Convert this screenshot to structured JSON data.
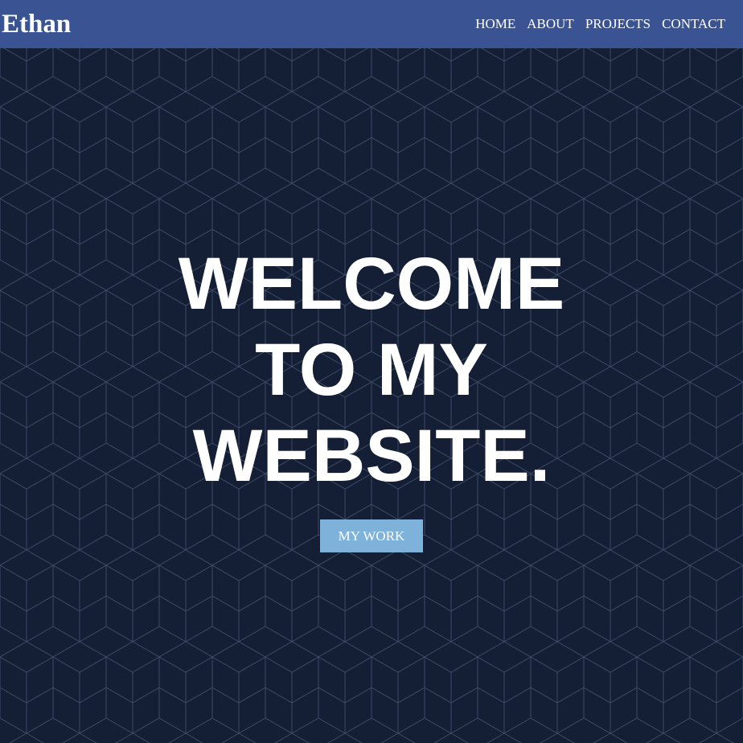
{
  "navbar": {
    "brand": "Ethan",
    "links": [
      "HOME",
      "ABOUT",
      "PROJECTS",
      "CONTACT"
    ]
  },
  "hero": {
    "lines": [
      "WELCOME",
      "TO MY",
      "WEBSITE."
    ],
    "button_label": "MY WORK"
  },
  "colors": {
    "navbar_bg": "#3a5493",
    "page_bg": "#141f36",
    "pattern_line": "#3d4a64",
    "button_bg": "#7fb2db",
    "text": "#ffffff"
  },
  "background_pattern": "isometric-cube-grid"
}
